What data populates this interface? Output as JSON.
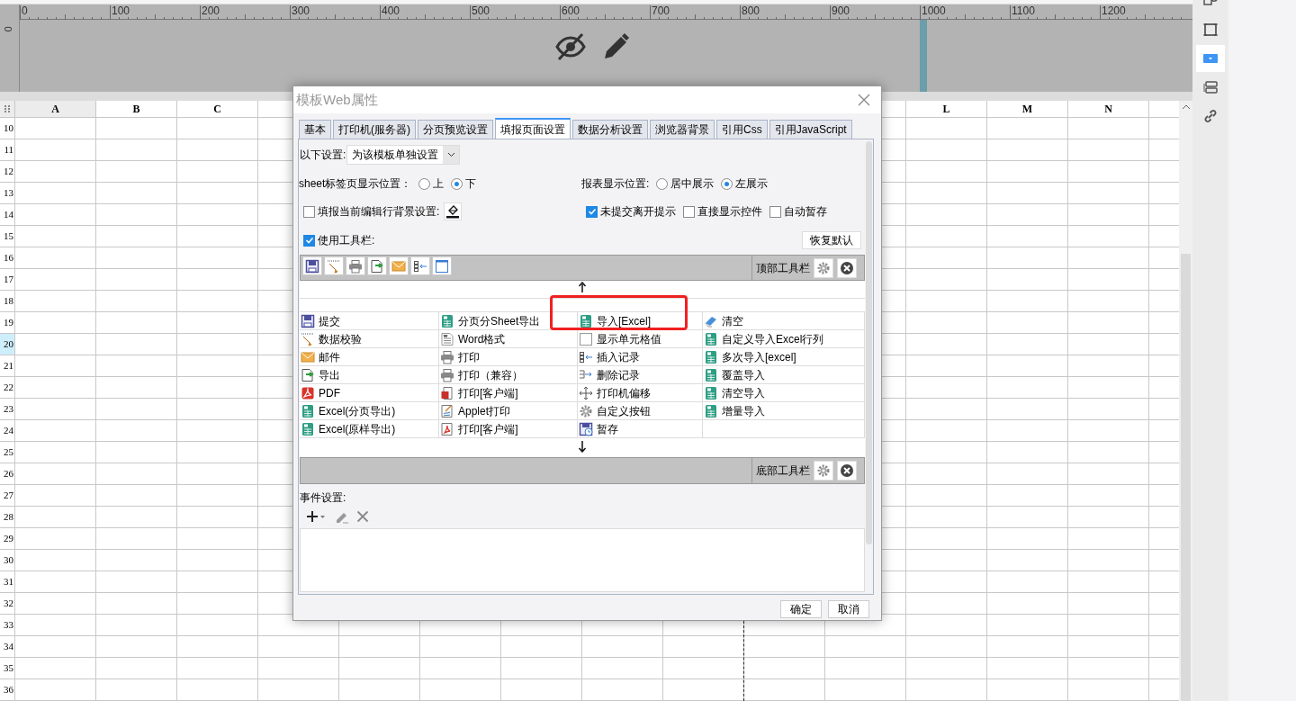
{
  "ruler": {
    "labels": [
      "0",
      "100",
      "200",
      "300",
      "400",
      "500",
      "600",
      "700",
      "800",
      "900",
      "1000",
      "1100",
      "1200"
    ],
    "vertical_label": "0"
  },
  "sheet": {
    "column_headers": {
      "left": [
        {
          "label": "A",
          "selected": true
        },
        {
          "label": "B",
          "selected": false
        },
        {
          "label": "C",
          "selected": false
        }
      ],
      "right": [
        {
          "label": "L",
          "selected": false
        },
        {
          "label": "M",
          "selected": false
        },
        {
          "label": "N",
          "selected": false
        }
      ]
    },
    "rows": [
      {
        "label": "10",
        "selected": false
      },
      {
        "label": "11",
        "selected": false
      },
      {
        "label": "12",
        "selected": false
      },
      {
        "label": "13",
        "selected": false
      },
      {
        "label": "14",
        "selected": false
      },
      {
        "label": "15",
        "selected": false
      },
      {
        "label": "16",
        "selected": false
      },
      {
        "label": "17",
        "selected": false
      },
      {
        "label": "18",
        "selected": false
      },
      {
        "label": "19",
        "selected": false
      },
      {
        "label": "20",
        "selected": true
      },
      {
        "label": "21",
        "selected": false
      },
      {
        "label": "22",
        "selected": false
      },
      {
        "label": "23",
        "selected": false
      },
      {
        "label": "24",
        "selected": false
      },
      {
        "label": "25",
        "selected": false
      },
      {
        "label": "26",
        "selected": false
      },
      {
        "label": "27",
        "selected": false
      },
      {
        "label": "28",
        "selected": false
      },
      {
        "label": "29",
        "selected": false
      },
      {
        "label": "30",
        "selected": false
      },
      {
        "label": "31",
        "selected": false
      },
      {
        "label": "32",
        "selected": false
      },
      {
        "label": "33",
        "selected": false
      },
      {
        "label": "34",
        "selected": false
      },
      {
        "label": "35",
        "selected": false
      },
      {
        "label": "36",
        "selected": false
      }
    ]
  },
  "side_panel": [
    {
      "kind": "info",
      "selected": false
    },
    {
      "kind": "frame",
      "selected": false
    },
    {
      "kind": "dropdown",
      "selected": true
    },
    {
      "kind": "stack",
      "selected": false
    },
    {
      "kind": "link",
      "selected": false
    }
  ],
  "dialog": {
    "title": "模板Web属性",
    "tabs": [
      {
        "label": "基本",
        "selected": false
      },
      {
        "label": "打印机(服务器)",
        "selected": false
      },
      {
        "label": "分页预览设置",
        "selected": false
      },
      {
        "label": "填报页面设置",
        "selected": true
      },
      {
        "label": "数据分析设置",
        "selected": false
      },
      {
        "label": "浏览器背景",
        "selected": false
      },
      {
        "label": "引用Css",
        "selected": false
      },
      {
        "label": "引用JavaScript",
        "selected": false
      }
    ],
    "scope": {
      "label": "以下设置:",
      "value": "为该模板单独设置"
    },
    "sheet_tab_position": {
      "label": "sheet标签页显示位置：",
      "options": [
        {
          "label": "上",
          "selected": false
        },
        {
          "label": "下",
          "selected": true
        }
      ]
    },
    "report_position": {
      "label": "报表显示位置:",
      "options": [
        {
          "label": "居中展示",
          "selected": false
        },
        {
          "label": "左展示",
          "selected": true
        }
      ]
    },
    "row_background": {
      "label": "填报当前编辑行背景设置:",
      "checked": false
    },
    "options": [
      {
        "label": "未提交离开提示",
        "checked": true
      },
      {
        "label": "直接显示控件",
        "checked": false
      },
      {
        "label": "自动暂存",
        "checked": false
      }
    ],
    "use_toolbar": {
      "label": "使用工具栏:",
      "checked": true
    },
    "restore_button": "恢复默认",
    "top_toolbar": {
      "label": "顶部工具栏",
      "buttons": [
        {
          "kind": "save"
        },
        {
          "kind": "validate"
        },
        {
          "kind": "print"
        },
        {
          "kind": "export"
        },
        {
          "kind": "mail"
        },
        {
          "kind": "insert"
        },
        {
          "kind": "window"
        }
      ]
    },
    "button_grid": [
      [
        {
          "kind": "save",
          "label": "提交"
        },
        {
          "kind": "excel",
          "label": "分页分Sheet导出"
        },
        {
          "kind": "excel",
          "label": "导入[Excel]"
        },
        {
          "kind": "eraser",
          "label": "清空"
        }
      ],
      [
        {
          "kind": "validate",
          "label": "数据校验"
        },
        {
          "kind": "word",
          "label": "Word格式"
        },
        {
          "kind": "cell",
          "label": "显示单元格值"
        },
        {
          "kind": "excel",
          "label": "自定义导入Excel行列"
        }
      ],
      [
        {
          "kind": "mail",
          "label": "邮件"
        },
        {
          "kind": "print",
          "label": "打印"
        },
        {
          "kind": "insert",
          "label": "插入记录"
        },
        {
          "kind": "excel",
          "label": "多次导入[excel]"
        }
      ],
      [
        {
          "kind": "export",
          "label": "导出"
        },
        {
          "kind": "print",
          "label": "打印（兼容）"
        },
        {
          "kind": "delete",
          "label": "删除记录"
        },
        {
          "kind": "excel",
          "label": "覆盖导入"
        }
      ],
      [
        {
          "kind": "pdf",
          "label": "PDF"
        },
        {
          "kind": "flash",
          "label": "打印[客户端]"
        },
        {
          "kind": "move",
          "label": "打印机偏移"
        },
        {
          "kind": "excel",
          "label": "清空导入"
        }
      ],
      [
        {
          "kind": "excel",
          "label": "Excel(分页导出)"
        },
        {
          "kind": "applet",
          "label": "Applet打印"
        },
        {
          "kind": "gear",
          "label": "自定义按钮"
        },
        {
          "kind": "excel",
          "label": "增量导入"
        }
      ],
      [
        {
          "kind": "excel",
          "label": "Excel(原样导出)"
        },
        {
          "kind": "pdfprint",
          "label": "打印[客户端]"
        },
        {
          "kind": "saveclock",
          "label": "暂存"
        }
      ]
    ],
    "bottom_toolbar": {
      "label": "底部工具栏"
    },
    "events": {
      "label": "事件设置:"
    },
    "buttons": [
      "确定",
      "取消"
    ]
  }
}
